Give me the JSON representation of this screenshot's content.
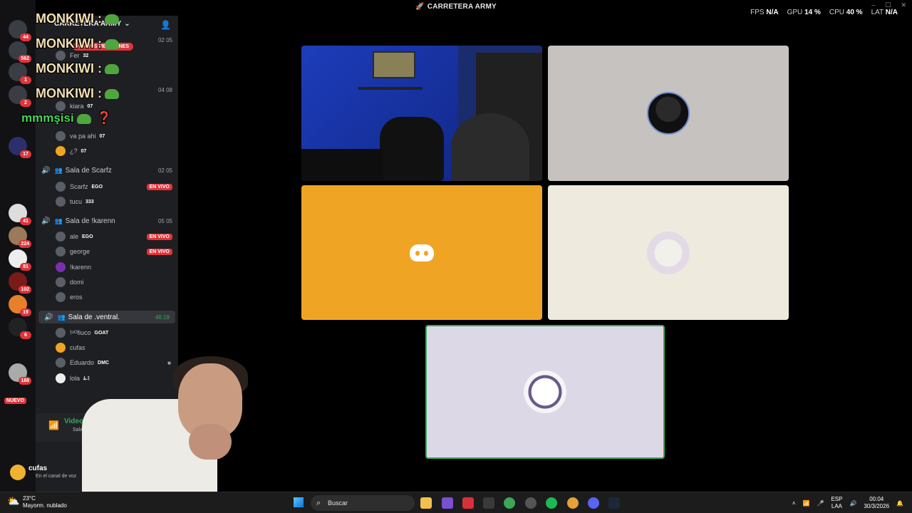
{
  "titlebar": {
    "title": "CARRETERA ARMY",
    "fps_label": "FPS",
    "fps_value": "N/A",
    "gpu_label": "GPU",
    "gpu_value": "14 %",
    "cpu_label": "CPU",
    "cpu_value": "40 %",
    "lat_label": "LAT",
    "lat_value": "N/A"
  },
  "servers": {
    "badges": [
      "44",
      "562",
      "1",
      "2",
      "17",
      "41",
      "224",
      "81",
      "102",
      "19",
      "6",
      "188"
    ],
    "new_label": "NUEVO"
  },
  "sidebar": {
    "server_name": "CARRETERA ARMY",
    "new_mentions": "NUEVAS MENCIONES",
    "channels": [
      {
        "name": "Sala de Scarfz",
        "count": "02 05"
      },
      {
        "name": "Sala de !karenn",
        "count": "05 05"
      },
      {
        "name": "Sala de .ventral.",
        "count": "46:19"
      }
    ],
    "hidden_counts": [
      "02 05",
      "04 08"
    ],
    "users_top": [
      {
        "name": "Fer",
        "tag": "32"
      },
      {
        "name": "kiara",
        "tag": "07"
      },
      {
        "name": "va pa ahi",
        "tag": "07"
      },
      {
        "name": "¿?",
        "tag": "07"
      }
    ],
    "users_scarfz": [
      {
        "name": "Scarfz",
        "tag": "EGO",
        "live": "EN VIVO"
      },
      {
        "name": "tucu",
        "tag": "333"
      }
    ],
    "users_karenn": [
      {
        "name": "ale",
        "tag": "EGO",
        "live": "EN VIVO"
      },
      {
        "name": "george",
        "tag": "",
        "live": "EN VIVO"
      },
      {
        "name": "!karenn",
        "tag": ""
      },
      {
        "name": "domi",
        "tag": ""
      },
      {
        "name": "eros",
        "tag": ""
      }
    ],
    "users_ventral": [
      {
        "name": "!ᵒᴼfiuco",
        "tag": "GOAT"
      },
      {
        "name": "cufas",
        "tag": ""
      },
      {
        "name": "Eduardo",
        "tag": "DMC"
      },
      {
        "name": "lola",
        "tag": "ﾑ.ﾐ"
      }
    ]
  },
  "chat_overlay": [
    "MONKIWI :",
    "MONKIWI :",
    "MONKIWI :",
    "MONKIWI :",
    "mmmşisi"
  ],
  "voice": {
    "status": "Video conectado",
    "location": "Sala de .ventral. / CA"
  },
  "user_panel": {
    "name": "cufas",
    "status": "En el canal de voz"
  },
  "taskbar": {
    "temp": "23°C",
    "weather": "Mayorm. nublado",
    "search_placeholder": "Buscar",
    "lang1": "ESP",
    "lang2": "LAA",
    "time": "00:04",
    "date": "30/3/2026"
  },
  "colors": {
    "accent_green": "#3ba55d",
    "live_red": "#e0343b",
    "orange_tile": "#f0a423"
  }
}
